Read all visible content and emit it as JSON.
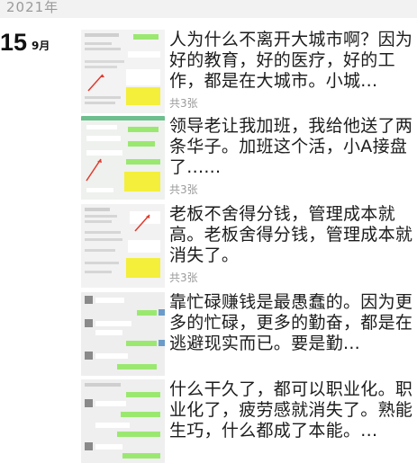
{
  "year_header": "2021年",
  "date": {
    "day": "15",
    "month": "9月"
  },
  "posts": [
    {
      "text": "人为什么不离开大城市啊？因为好的教育，好的医疗，好的工作，都是在大城市。小城...",
      "count": "共3张"
    },
    {
      "text": "领导老让我加班，我给他送了两条华子。加班这个活，小A接盘了......",
      "count": "共3张"
    },
    {
      "text": "老板不舍得分钱，管理成本就高。老板舍得分钱，管理成本就消失了。",
      "count": "共3张"
    },
    {
      "text": "靠忙碌赚钱是最愚蠢的。因为更多的忙碌，更多的勤奋，都是在逃避现实而已。要是勤...",
      "count": ""
    },
    {
      "text": "什么干久了，都可以职业化。职业化了，疲劳感就消失了。熟能生巧，什么都成了本能。...",
      "count": ""
    }
  ],
  "colors": {
    "chat_green": "#9be870",
    "highlight_yellow": "#f4ef3a",
    "arrow_red": "#e03a2e"
  }
}
